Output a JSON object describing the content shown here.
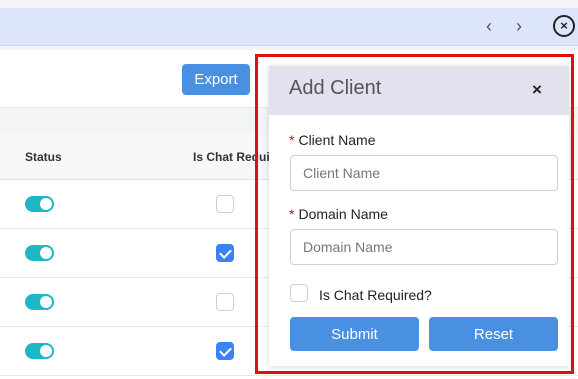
{
  "nav": {
    "prev_icon": "‹",
    "next_icon": "›",
    "close_icon": "×"
  },
  "toolbar": {
    "export_label": "Export"
  },
  "table": {
    "headers": {
      "status": "Status",
      "chat": "Is Chat Require"
    },
    "rows": [
      {
        "status_on": true,
        "chat_required": false
      },
      {
        "status_on": true,
        "chat_required": true
      },
      {
        "status_on": true,
        "chat_required": false
      },
      {
        "status_on": true,
        "chat_required": true
      }
    ]
  },
  "modal": {
    "title": "Add Client",
    "close_icon": "×",
    "required_marker": "*",
    "client_name_label": "Client Name",
    "client_name_placeholder": "Client Name",
    "domain_name_label": "Domain Name",
    "domain_name_placeholder": "Domain Name",
    "chat_required_label": "Is Chat Required?",
    "submit_label": "Submit",
    "reset_label": "Reset"
  },
  "colors": {
    "accent": "#4a90e2",
    "toggle": "#1fb6c6",
    "highlight": "#e01010",
    "modal_header": "#e4e1ee"
  }
}
